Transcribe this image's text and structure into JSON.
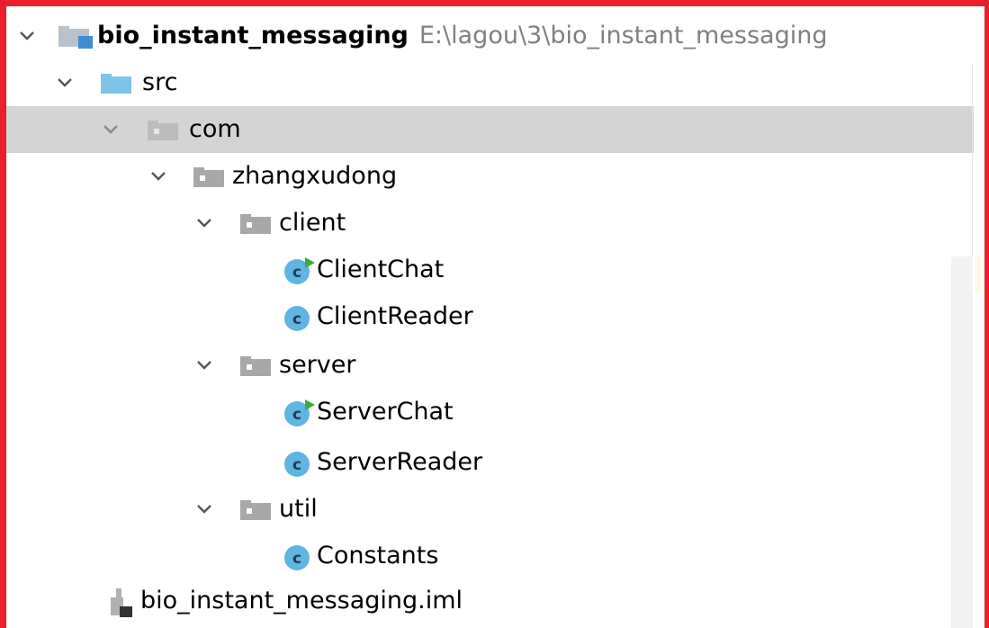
{
  "project": {
    "name": "bio_instant_messaging",
    "path": "E:\\lagou\\3\\bio_instant_messaging"
  },
  "tree": {
    "src": "src",
    "com": "com",
    "zhangxudong": "zhangxudong",
    "client": "client",
    "client_chat": "ClientChat",
    "client_reader": "ClientReader",
    "server": "server",
    "server_chat": "ServerChat",
    "server_reader": "ServerReader",
    "util": "util",
    "constants": "Constants",
    "iml_file": "bio_instant_messaging.iml"
  },
  "icons": {
    "class_letter": "c",
    "class_color": "#5fb4e0",
    "run_marker_color": "#3daa3d",
    "source_folder_color": "#7ec4e8",
    "package_folder_color": "#a8a8a8"
  }
}
